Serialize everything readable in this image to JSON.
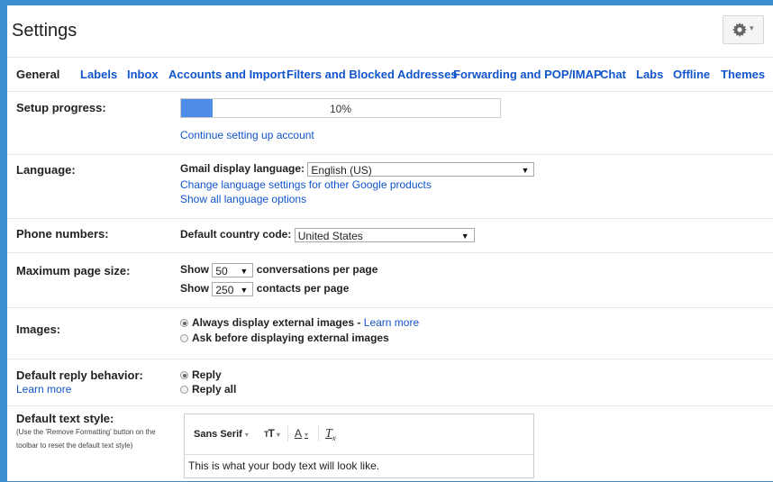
{
  "header": {
    "title": "Settings"
  },
  "tabs": [
    {
      "label": "General",
      "active": true
    },
    {
      "label": "Labels"
    },
    {
      "label": "Inbox"
    },
    {
      "label": "Accounts and Import"
    },
    {
      "label": "Filters and Blocked Addresses"
    },
    {
      "label": "Forwarding and POP/IMAP"
    },
    {
      "label": "Chat"
    },
    {
      "label": "Labs"
    },
    {
      "label": "Offline"
    },
    {
      "label": "Themes"
    }
  ],
  "setup": {
    "label": "Setup progress:",
    "progress_fraction": 0.1,
    "progress_text": "10%",
    "link": "Continue setting up account"
  },
  "language": {
    "label": "Language:",
    "field_label": "Gmail display language:",
    "selected": "English (US)",
    "link1": "Change language settings for other Google products",
    "link2": "Show all language options"
  },
  "phone": {
    "label": "Phone numbers:",
    "field_label": "Default country code:",
    "selected": "United States"
  },
  "page_size": {
    "label": "Maximum page size:",
    "show": "Show",
    "conv_value": "50",
    "conv_text": "conversations per page",
    "contacts_value": "250",
    "contacts_text": "contacts per page"
  },
  "images": {
    "label": "Images:",
    "option1": "Always display external images",
    "option1_sep": " - ",
    "option1_link": "Learn more",
    "option2": "Ask before displaying external images"
  },
  "reply": {
    "label": "Default reply behavior:",
    "learn_more": "Learn more",
    "option1": "Reply",
    "option2": "Reply all"
  },
  "text_style": {
    "label": "Default text style:",
    "hint": "(Use the 'Remove Formatting' button on the toolbar to reset the default text style)",
    "font": "Sans Serif",
    "preview": "This is what your body text will look like."
  },
  "colors": {
    "link": "#1155cc",
    "progress": "#4d8de8",
    "background": "#3b8fd0"
  },
  "icons": [
    "gear-icon",
    "font-size-icon",
    "text-color-icon",
    "remove-formatting-icon"
  ]
}
